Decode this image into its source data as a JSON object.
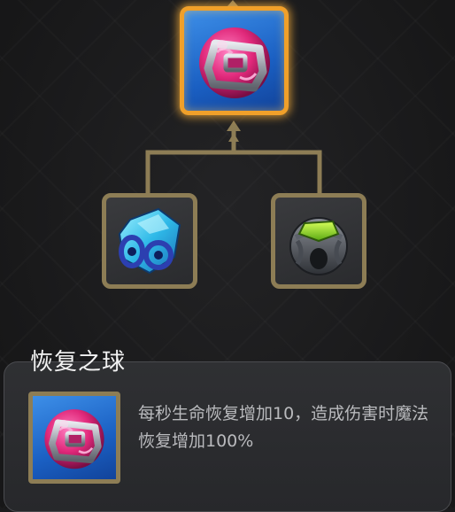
{
  "item_tree": {
    "main_item": {
      "icon": "recovery-orb-icon"
    },
    "components": [
      {
        "icon": "blue-crystal-gem-icon"
      },
      {
        "icon": "green-gem-orb-icon"
      }
    ]
  },
  "tooltip": {
    "name": "恢复之球",
    "description": "每秒生命恢复增加10，造成伤害时魔法恢复增加100%",
    "icon": "recovery-orb-icon"
  },
  "colors": {
    "selected_border": "#f0a02a",
    "frame_border": "#8d7d55",
    "connector": "#8d7d55",
    "orb_pink": "#e0287a",
    "slot_blue": "#2a74d8"
  }
}
